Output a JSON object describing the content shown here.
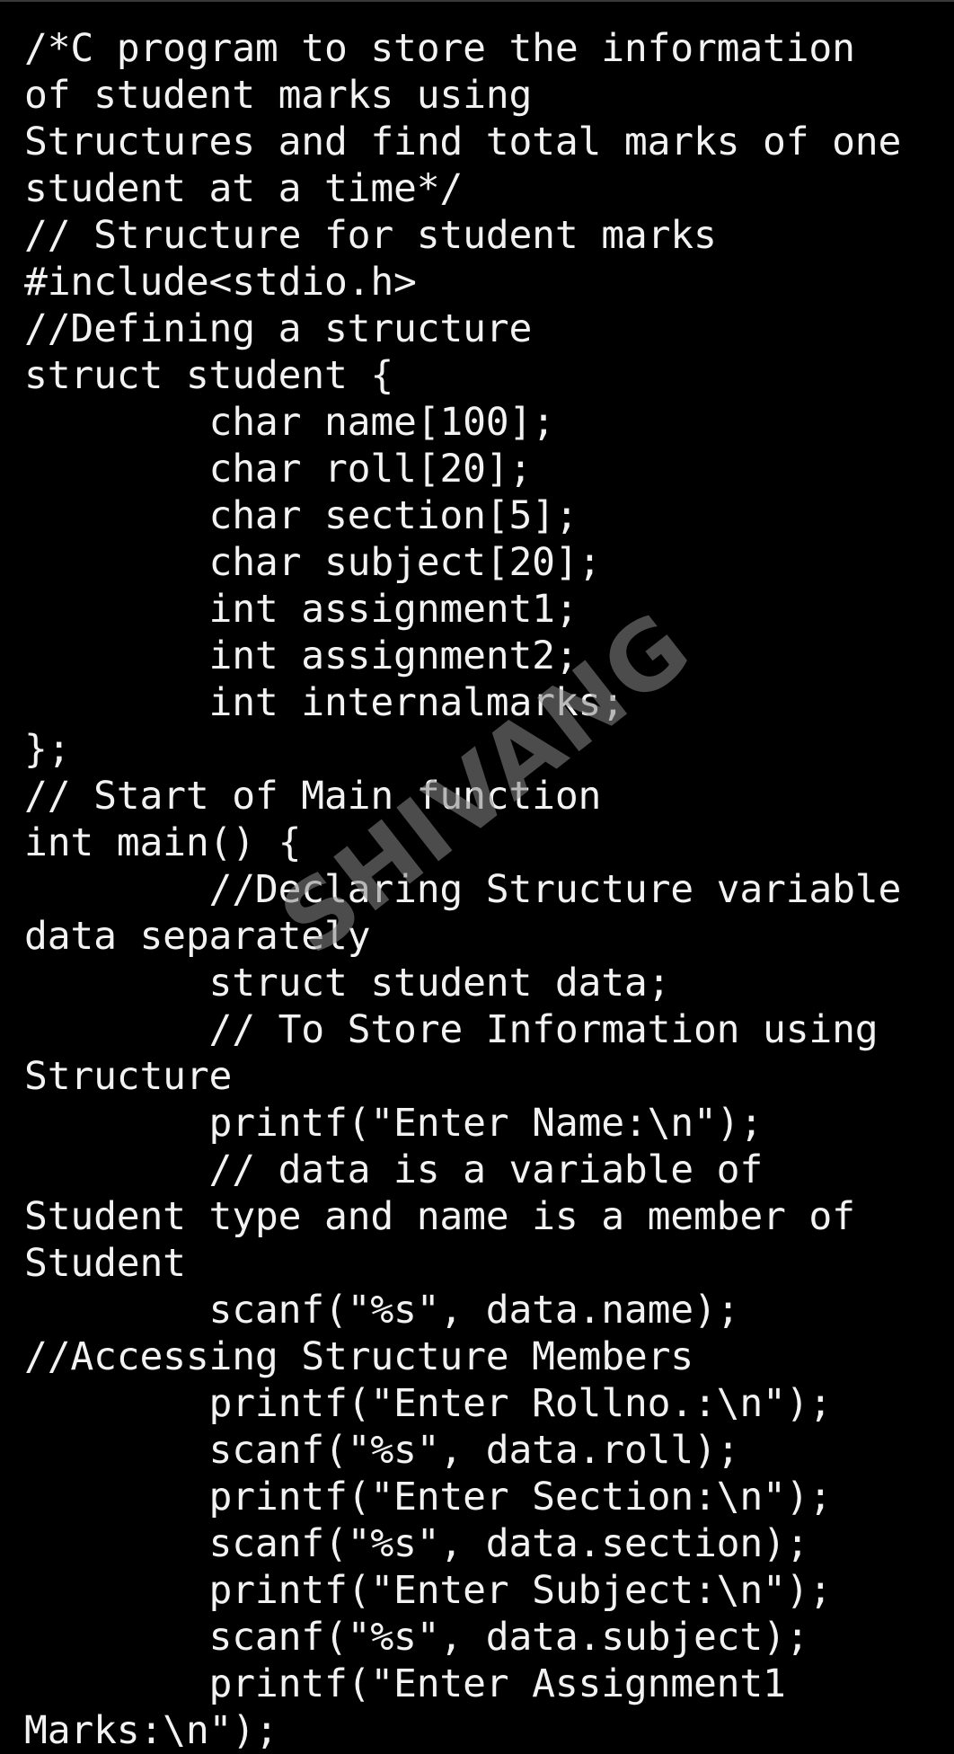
{
  "code": {
    "lines": [
      "/*C program to store the information",
      "of student marks using",
      "Structures and find total marks of one",
      "student at a time*/",
      "// Structure for student marks",
      "#include<stdio.h>",
      "//Defining a structure",
      "struct student {",
      "        char name[100];",
      "        char roll[20];",
      "        char section[5];",
      "        char subject[20];",
      "        int assignment1;",
      "        int assignment2;",
      "        int internalmarks;",
      "};",
      "// Start of Main function",
      "int main() {",
      "        //Declaring Structure variable",
      "data separately",
      "        struct student data;",
      "        // To Store Information using",
      "Structure",
      "        printf(\"Enter Name:\\n\");",
      "        // data is a variable of",
      "Student type and name is a member of",
      "Student",
      "        scanf(\"%s\", data.name);",
      "//Accessing Structure Members",
      "        printf(\"Enter Rollno.:\\n\");",
      "        scanf(\"%s\", data.roll);",
      "        printf(\"Enter Section:\\n\");",
      "        scanf(\"%s\", data.section);",
      "        printf(\"Enter Subject:\\n\");",
      "        scanf(\"%s\", data.subject);",
      "        printf(\"Enter Assignment1",
      "Marks:\\n\");"
    ]
  },
  "watermark": {
    "text": "SHIVANG"
  },
  "colors": {
    "background": "#000000",
    "text": "#f2f2f2",
    "watermark": "#8a8a8a"
  }
}
